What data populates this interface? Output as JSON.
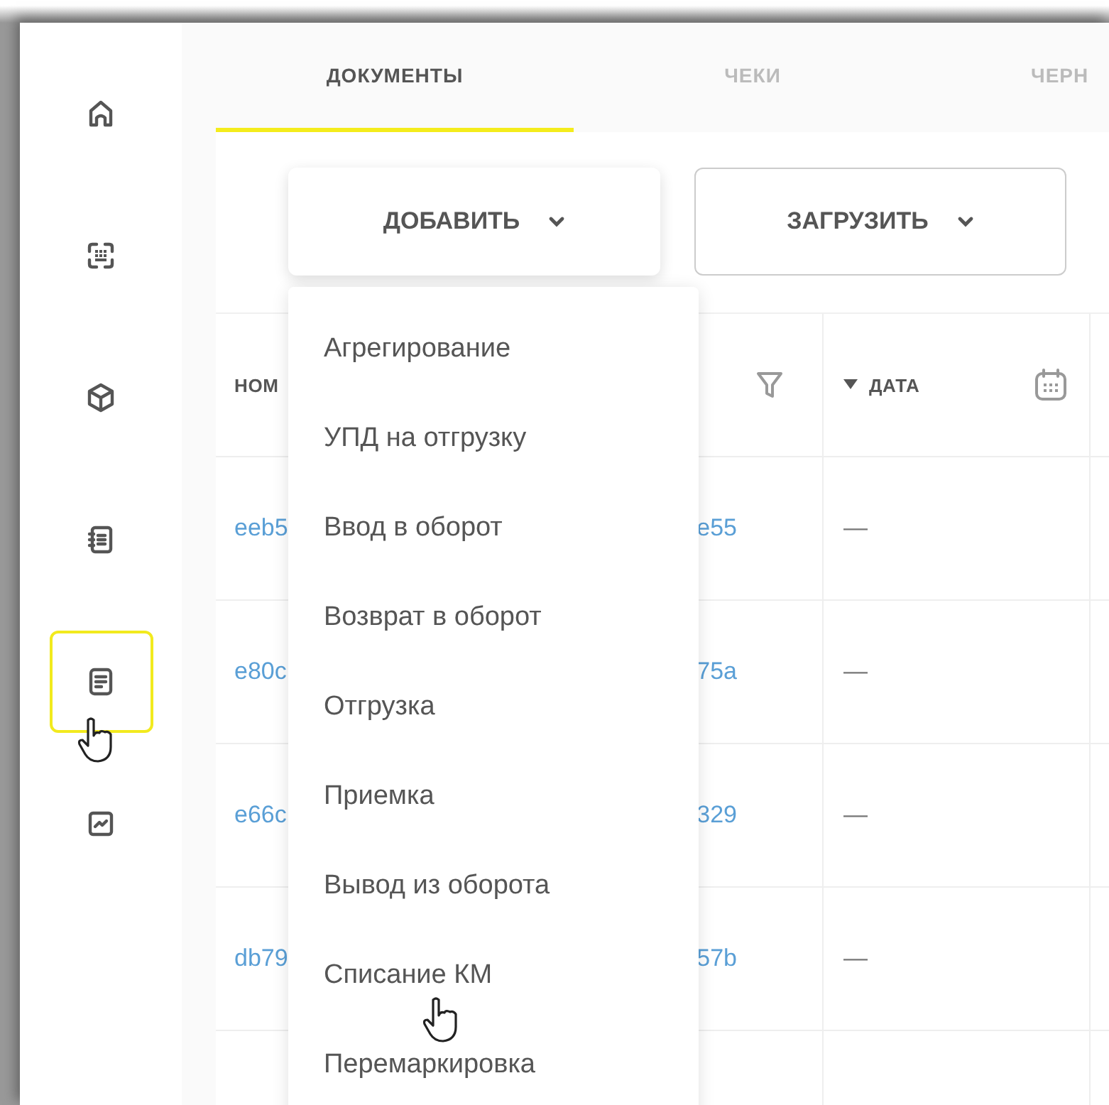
{
  "sidebar": {
    "items": [
      {
        "selected": false
      },
      {
        "selected": false
      },
      {
        "selected": false
      },
      {
        "selected": false
      },
      {
        "selected": true
      },
      {
        "selected": false
      }
    ]
  },
  "tabs": [
    {
      "label": "ДОКУМЕНТЫ",
      "selected": true
    },
    {
      "label": "ЧЕКИ",
      "selected": false
    },
    {
      "label": "ЧЕРН",
      "selected": false
    }
  ],
  "buttons": [
    {
      "label": "ДОБАВИТЬ",
      "kind": "raised"
    },
    {
      "label": "ЗАГРУЗИТЬ",
      "kind": "outlined"
    }
  ],
  "table": {
    "columns": [
      {
        "label": "НОМ"
      },
      {
        "label": "ДАТА"
      }
    ],
    "rows": [
      {
        "id_start": "eeb5",
        "id_end": "e55",
        "date": "—"
      },
      {
        "id_start": "e80c",
        "id_end": "75a",
        "date": "—"
      },
      {
        "id_start": "e66c",
        "id_end": "329",
        "date": "—"
      },
      {
        "id_start": "db79",
        "id_end": "57b",
        "date": "—"
      }
    ]
  },
  "dropdown": {
    "items": [
      "Агрегирование",
      "УПД на отгрузку",
      "Ввод в оборот",
      "Возврат в оборот",
      "Отгрузка",
      "Приемка",
      "Вывод из оборота",
      "Списание КМ",
      "Перемаркировка"
    ]
  }
}
